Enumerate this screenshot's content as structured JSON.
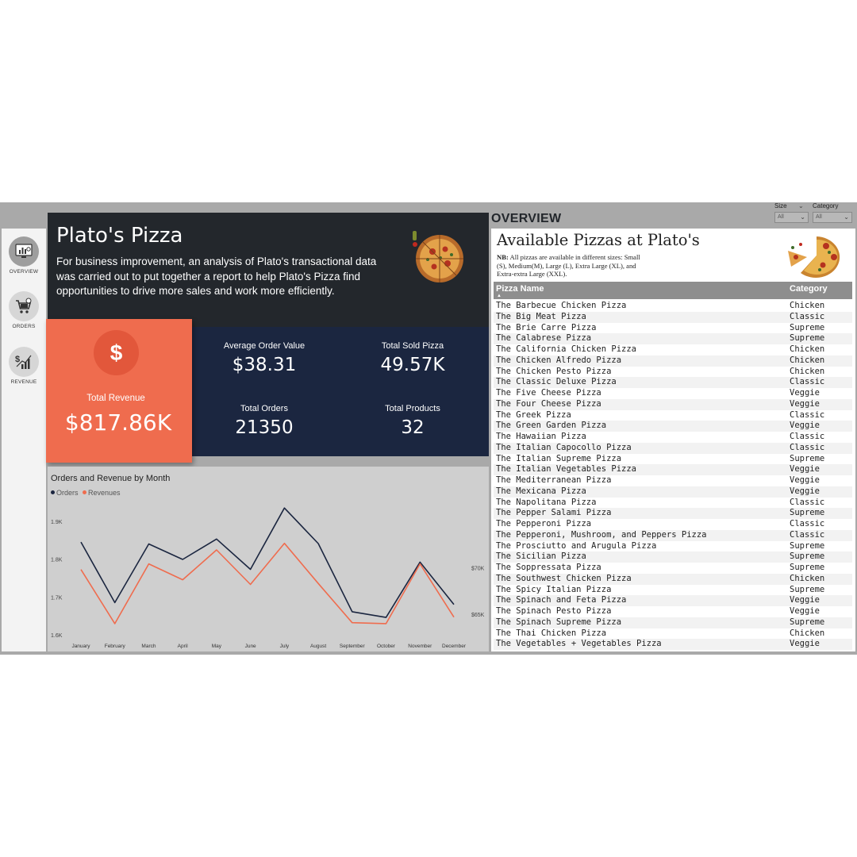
{
  "sidebar": {
    "items": [
      {
        "label": "OVERVIEW",
        "icon": "monitor-chart-icon"
      },
      {
        "label": "ORDERS",
        "icon": "shopping-cart-icon"
      },
      {
        "label": "REVENUE",
        "icon": "dollar-growth-icon"
      }
    ]
  },
  "header": {
    "title": "Plato's Pizza",
    "description": "For business improvement, an analysis of Plato's transactional data was carried out to put together a report to help Plato's Pizza find opportunities to drive more sales and work more efficiently."
  },
  "kpis": {
    "total_revenue": {
      "label": "Total Revenue",
      "value": "$817.86K",
      "icon_glyph": "$"
    },
    "avg_order_value": {
      "label": "Average Order Value",
      "value": "$38.31"
    },
    "total_sold_pizza": {
      "label": "Total Sold Pizza",
      "value": "49.57K"
    },
    "total_orders": {
      "label": "Total Orders",
      "value": "21350"
    },
    "total_products": {
      "label": "Total Products",
      "value": "32"
    }
  },
  "colors": {
    "header_bg": "#23272c",
    "kpi_bg": "#1b2640",
    "accent": "#ef6c4e",
    "orders_line": "#1b2640",
    "revenues_line": "#ef6c4e"
  },
  "chart_data": {
    "type": "line",
    "title": "Orders and Revenue by Month",
    "categories": [
      "January",
      "February",
      "March",
      "April",
      "May",
      "June",
      "July",
      "August",
      "September",
      "October",
      "November",
      "December"
    ],
    "series": [
      {
        "name": "Orders",
        "axis": "left",
        "color": "#1b2640",
        "values": [
          1845,
          1685,
          1840,
          1799,
          1853,
          1773,
          1935,
          1841,
          1661,
          1646,
          1792,
          1680
        ]
      },
      {
        "name": "Revenues",
        "axis": "right",
        "color": "#ef6c4e",
        "values": [
          69800,
          64000,
          70400,
          68700,
          71900,
          68200,
          72600,
          68300,
          64100,
          64000,
          70400,
          64700
        ]
      }
    ],
    "y_left": {
      "ticks": [
        "1.6K",
        "1.7K",
        "1.8K",
        "1.9K"
      ],
      "range": [
        1600,
        1950
      ]
    },
    "y_right": {
      "ticks": [
        "$65K",
        "$70K"
      ],
      "range": [
        62800,
        77000
      ]
    },
    "legend": "top-left"
  },
  "overview_title": "OVERVIEW",
  "slicers": [
    {
      "label": "Size",
      "value": "All"
    },
    {
      "label": "Category",
      "value": "All"
    }
  ],
  "table": {
    "title": "Available Pizzas at Plato's",
    "note_prefix": "NB:",
    "note": " All pizzas are available in different sizes: Small (S), Medium(M), Large (L), Extra Large (XL), and Extra-extra Large (XXL).",
    "columns": [
      "Pizza Name",
      "Category"
    ],
    "rows": [
      [
        "The Barbecue Chicken Pizza",
        "Chicken"
      ],
      [
        "The Big Meat Pizza",
        "Classic"
      ],
      [
        "The Brie Carre Pizza",
        "Supreme"
      ],
      [
        "The Calabrese Pizza",
        "Supreme"
      ],
      [
        "The California Chicken Pizza",
        "Chicken"
      ],
      [
        "The Chicken Alfredo Pizza",
        "Chicken"
      ],
      [
        "The Chicken Pesto Pizza",
        "Chicken"
      ],
      [
        "The Classic Deluxe Pizza",
        "Classic"
      ],
      [
        "The Five Cheese Pizza",
        "Veggie"
      ],
      [
        "The Four Cheese Pizza",
        "Veggie"
      ],
      [
        "The Greek Pizza",
        "Classic"
      ],
      [
        "The Green Garden Pizza",
        "Veggie"
      ],
      [
        "The Hawaiian Pizza",
        "Classic"
      ],
      [
        "The Italian Capocollo Pizza",
        "Classic"
      ],
      [
        "The Italian Supreme Pizza",
        "Supreme"
      ],
      [
        "The Italian Vegetables Pizza",
        "Veggie"
      ],
      [
        "The Mediterranean Pizza",
        "Veggie"
      ],
      [
        "The Mexicana Pizza",
        "Veggie"
      ],
      [
        "The Napolitana Pizza",
        "Classic"
      ],
      [
        "The Pepper Salami Pizza",
        "Supreme"
      ],
      [
        "The Pepperoni Pizza",
        "Classic"
      ],
      [
        "The Pepperoni, Mushroom, and Peppers Pizza",
        "Classic"
      ],
      [
        "The Prosciutto and Arugula Pizza",
        "Supreme"
      ],
      [
        "The Sicilian Pizza",
        "Supreme"
      ],
      [
        "The Soppressata Pizza",
        "Supreme"
      ],
      [
        "The Southwest Chicken Pizza",
        "Chicken"
      ],
      [
        "The Spicy Italian Pizza",
        "Supreme"
      ],
      [
        "The Spinach and Feta Pizza",
        "Veggie"
      ],
      [
        "The Spinach Pesto Pizza",
        "Veggie"
      ],
      [
        "The Spinach Supreme Pizza",
        "Supreme"
      ],
      [
        "The Thai Chicken Pizza",
        "Chicken"
      ],
      [
        "The Vegetables + Vegetables Pizza",
        "Veggie"
      ]
    ]
  }
}
